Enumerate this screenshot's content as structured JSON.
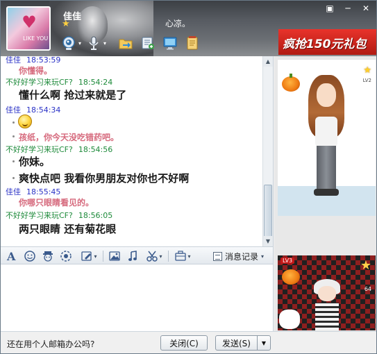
{
  "header": {
    "nickname": "佳佳",
    "signature": "心凉。",
    "avatar_text": "LIKE YOU",
    "window_controls": [
      "▣",
      "─",
      "✕"
    ]
  },
  "banner": {
    "text": "疯抢150元礼包"
  },
  "chat": {
    "messages": [
      {
        "type": "header",
        "sender": "佳佳",
        "time": "18:53:59",
        "role": "self"
      },
      {
        "type": "sub",
        "text": "你懂得。"
      },
      {
        "type": "header",
        "sender": "不好好学习来玩CF?",
        "time": "18:54:24",
        "role": "other"
      },
      {
        "type": "text",
        "text": "懂什么啊   抢过来就是了"
      },
      {
        "type": "header",
        "sender": "佳佳",
        "time": "18:54:34",
        "role": "self"
      },
      {
        "type": "emoji",
        "icon": "smiley-face-icon"
      },
      {
        "type": "sub",
        "text": "孩纸，你今天没吃错药吧。"
      },
      {
        "type": "header",
        "sender": "不好好学习来玩CF?",
        "time": "18:54:56",
        "role": "other"
      },
      {
        "type": "text",
        "text": "你妹。"
      },
      {
        "type": "text",
        "text": "爽快点吧  我看你男朋友对你也不好啊"
      },
      {
        "type": "header",
        "sender": "佳佳",
        "time": "18:55:45",
        "role": "self"
      },
      {
        "type": "sub",
        "text": "你哪只眼睛看见的。"
      },
      {
        "type": "header",
        "sender": "不好好学习来玩CF?",
        "time": "18:56:05",
        "role": "other"
      },
      {
        "type": "text",
        "text": "两只眼睛  还有菊花眼"
      }
    ]
  },
  "input_toolbar": {
    "history_label": "消息记录"
  },
  "bottom_bar": {
    "ad_text": "还在用个人邮箱办公吗?",
    "close_label": "关闭(C)",
    "send_label": "发送(S)"
  },
  "right_panel": {
    "top_level": "LV2",
    "bottom_level": "LV3",
    "bottom_count": "64"
  },
  "colors": {
    "self_sender": "#2a32c6",
    "other_sender": "#1d8a3a",
    "sub_text": "#d66a7d",
    "banner": "#e8332b"
  }
}
